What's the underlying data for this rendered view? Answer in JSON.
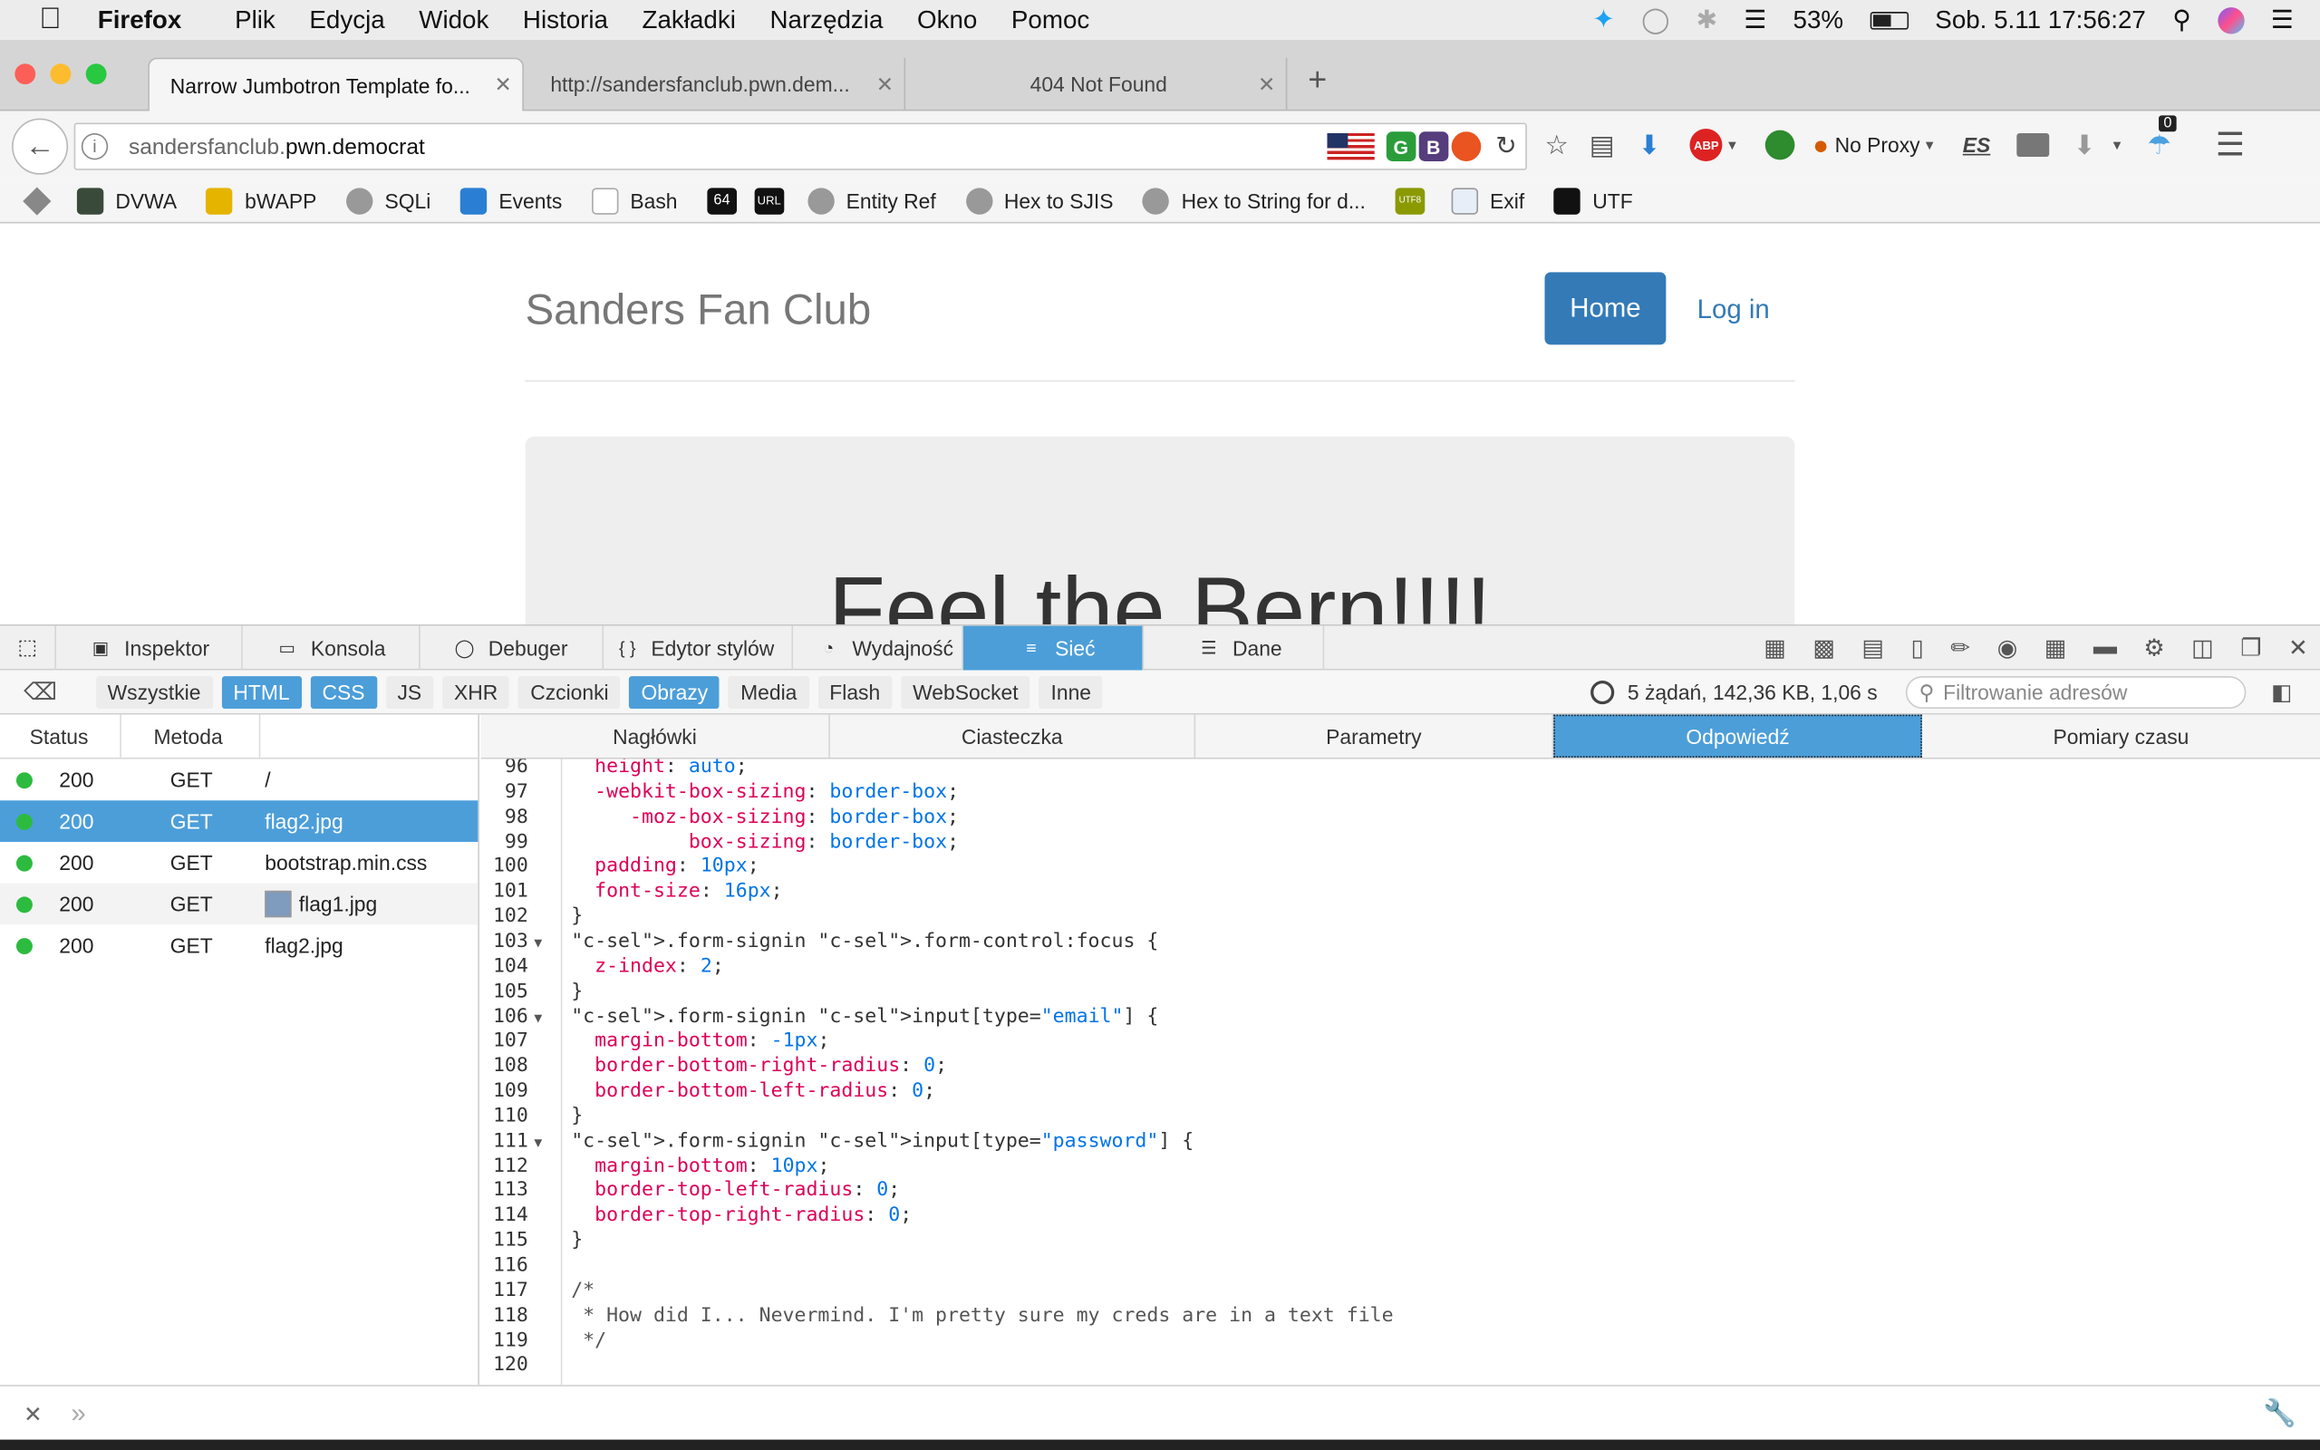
{
  "menubar": {
    "app": "Firefox",
    "items": [
      "Plik",
      "Edycja",
      "Widok",
      "Historia",
      "Zakładki",
      "Narzędzia",
      "Okno",
      "Pomoc"
    ],
    "battery": "53%",
    "clock": "Sob. 5.11  17:56:27"
  },
  "tabs": [
    {
      "title": "Narrow Jumbotron Template fo...",
      "active": true
    },
    {
      "title": "http://sandersfanclub.pwn.dem...",
      "active": false
    },
    {
      "title": "404 Not Found",
      "active": false
    }
  ],
  "urlbar": {
    "prefix": "sandersfanclub.",
    "domain": "pwn.democrat"
  },
  "toolbar": {
    "no_proxy": "No Proxy",
    "es_label": "ES",
    "badge_count": "0"
  },
  "bookmarks": [
    "DVWA",
    "bWAPP",
    "SQLi",
    "Events",
    "Bash",
    "64",
    "URL",
    "Entity Ref",
    "Hex to SJIS",
    "Hex to String for d...",
    "UTF8",
    "Exif",
    "UTF"
  ],
  "page": {
    "brand": "Sanders Fan Club",
    "home": "Home",
    "login": "Log in",
    "jumbo_heading": "Feel the Bern!!!!"
  },
  "devtools": {
    "tabs": [
      "Inspektor",
      "Konsola",
      "Debuger",
      "Edytor stylów",
      "Wydajność",
      "Sieć",
      "Dane"
    ],
    "selected_tab": "Sieć",
    "filters": [
      "Wszystkie",
      "HTML",
      "CSS",
      "JS",
      "XHR",
      "Czcionki",
      "Obrazy",
      "Media",
      "Flash",
      "WebSocket",
      "Inne"
    ],
    "active_filters": [
      "HTML",
      "CSS",
      "Obrazy"
    ],
    "summary": "5 żądań, 142,36 KB, 1,06 s",
    "filter_placeholder": "Filtrowanie adresów",
    "columns": [
      "Status",
      "Metoda"
    ],
    "requests": [
      {
        "status": "200",
        "method": "GET",
        "file": "/"
      },
      {
        "status": "200",
        "method": "GET",
        "file": "flag2.jpg"
      },
      {
        "status": "200",
        "method": "GET",
        "file": "bootstrap.min.css"
      },
      {
        "status": "200",
        "method": "GET",
        "file": "flag1.jpg"
      },
      {
        "status": "200",
        "method": "GET",
        "file": "flag2.jpg"
      }
    ],
    "selected_request": 1,
    "detail_tabs": [
      "Nagłówki",
      "Ciasteczka",
      "Parametry",
      "Odpowiedź",
      "Pomiary czasu"
    ],
    "selected_detail_tab": "Odpowiedź",
    "code_lines": [
      {
        "n": "96",
        "t": "  height: auto;"
      },
      {
        "n": "97",
        "t": "  -webkit-box-sizing: border-box;"
      },
      {
        "n": "98",
        "t": "     -moz-box-sizing: border-box;"
      },
      {
        "n": "99",
        "t": "          box-sizing: border-box;"
      },
      {
        "n": "100",
        "t": "  padding: 10px;"
      },
      {
        "n": "101",
        "t": "  font-size: 16px;"
      },
      {
        "n": "102",
        "t": "}"
      },
      {
        "n": "103",
        "t": ".form-signin .form-control:focus {"
      },
      {
        "n": "104",
        "t": "  z-index: 2;"
      },
      {
        "n": "105",
        "t": "}"
      },
      {
        "n": "106",
        "t": ".form-signin input[type=\"email\"] {"
      },
      {
        "n": "107",
        "t": "  margin-bottom: -1px;"
      },
      {
        "n": "108",
        "t": "  border-bottom-right-radius: 0;"
      },
      {
        "n": "109",
        "t": "  border-bottom-left-radius: 0;"
      },
      {
        "n": "110",
        "t": "}"
      },
      {
        "n": "111",
        "t": ".form-signin input[type=\"password\"] {"
      },
      {
        "n": "112",
        "t": "  margin-bottom: 10px;"
      },
      {
        "n": "113",
        "t": "  border-top-left-radius: 0;"
      },
      {
        "n": "114",
        "t": "  border-top-right-radius: 0;"
      },
      {
        "n": "115",
        "t": "}"
      },
      {
        "n": "116",
        "t": ""
      },
      {
        "n": "117",
        "t": "/*"
      },
      {
        "n": "118",
        "t": " * How did I... Nevermind. I'm pretty sure my creds are in a text file"
      },
      {
        "n": "119",
        "t": " */"
      },
      {
        "n": "120",
        "t": ""
      }
    ],
    "fold_lines": [
      "103",
      "106",
      "111"
    ]
  }
}
